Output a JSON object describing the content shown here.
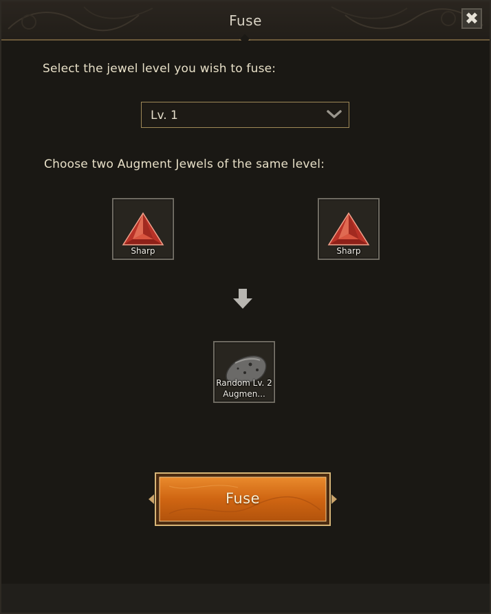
{
  "window": {
    "title": "Fuse",
    "close_icon": "close-icon"
  },
  "level": {
    "prompt": "Select the jewel level you wish to fuse:",
    "selected": "Lv. 1"
  },
  "jewels": {
    "prompt": "Choose two Augment Jewels of the same level:",
    "left": {
      "name": "Sharp",
      "icon": "red-triangle-jewel-icon"
    },
    "right": {
      "name": "Sharp",
      "icon": "red-triangle-jewel-icon"
    },
    "result": {
      "name": "Random Lv. 2 Augmen...",
      "line1": "Random Lv. 2",
      "line2": "Augmen...",
      "icon": "grey-rock-icon"
    }
  },
  "actions": {
    "fuse_label": "Fuse"
  },
  "colors": {
    "accent_gold": "#a08a58",
    "button_orange": "#d86f14",
    "jewel_red": "#c94032"
  }
}
